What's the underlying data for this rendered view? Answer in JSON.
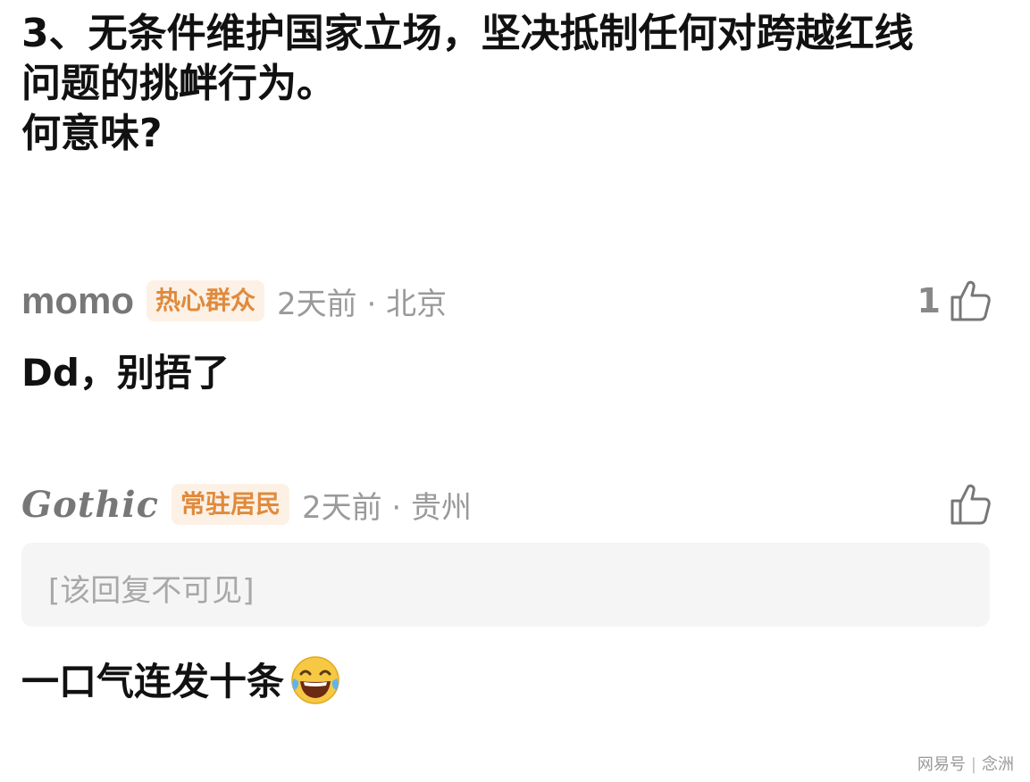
{
  "post": {
    "lines": [
      "3、无条件维护国家立场，坚决抵制任何对跨越红线",
      "问题的挑衅行为。",
      "何意味?"
    ]
  },
  "comments": [
    {
      "username": "momo",
      "badge": "热心群众",
      "meta": "2天前 · 北京",
      "likes": "1",
      "body": "Dd，别捂了"
    },
    {
      "username": "Gothic",
      "badge": "常驻居民",
      "meta": "2天前 · 贵州",
      "likes": "",
      "hidden_reply": "[该回复不可见]",
      "body": "一口气连发十条",
      "body_emoji": "laughing-tears-emoji"
    }
  ],
  "watermark": {
    "brand": "网易号",
    "author": "念洲"
  },
  "colors": {
    "badge_bg": "#fdf1e6",
    "badge_text": "#e08a3c",
    "meta_text": "#9a9a9a",
    "username_text": "#777777"
  }
}
